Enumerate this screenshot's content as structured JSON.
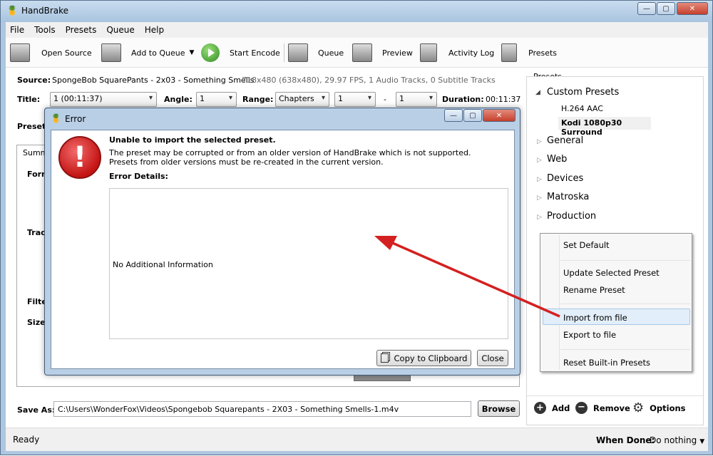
{
  "app": {
    "title": "HandBrake"
  },
  "menu": [
    "File",
    "Tools",
    "Presets",
    "Queue",
    "Help"
  ],
  "toolbar": {
    "open_source": "Open Source",
    "add_to_queue": "Add to Queue",
    "start_encode": "Start Encode",
    "queue": "Queue",
    "preview": "Preview",
    "activity_log": "Activity Log",
    "presets": "Presets"
  },
  "source": {
    "label": "Source:",
    "name": "SpongeBob SquarePants - 2x03 - Something Smells",
    "info": "718x480 (638x480), 29.97 FPS, 1 Audio Tracks, 0 Subtitle Tracks"
  },
  "title_row": {
    "title_label": "Title:",
    "title_value": "1  (00:11:37)",
    "angle_label": "Angle:",
    "angle_value": "1",
    "range_label": "Range:",
    "range_value": "Chapters",
    "range_from": "1",
    "dash": "-",
    "range_to": "1",
    "duration_label": "Duration:",
    "duration_value": "00:11:37"
  },
  "preset_label": "Preset:",
  "tabs": {
    "summary": "Summ"
  },
  "summary_labels": {
    "format": "Form",
    "tracks": "Track",
    "filters": "Filter",
    "size": "Size:"
  },
  "presets_panel": {
    "header": "Presets",
    "custom": "Custom Presets",
    "custom_items": [
      "H.264 AAC",
      "Kodi 1080p30 Surround"
    ],
    "groups": [
      "General",
      "Web",
      "Devices",
      "Matroska",
      "Production"
    ],
    "add": "Add",
    "remove": "Remove",
    "options": "Options"
  },
  "context_menu": {
    "set_default": "Set Default",
    "update": "Update Selected Preset",
    "rename": "Rename Preset",
    "import": "Import from file",
    "export": "Export to file",
    "reset": "Reset Built-in Presets"
  },
  "dialog": {
    "title": "Error",
    "heading": "Unable to import the selected preset.",
    "line1": "The preset may be corrupted or from an older version of HandBrake which is not supported.",
    "line2": "Presets from older versions must be re-created in the current version.",
    "details_label": "Error Details:",
    "details_text": "No Additional Information",
    "copy_button": "Copy to Clipboard",
    "close_button": "Close"
  },
  "save_as": {
    "label": "Save As:",
    "path": "C:\\Users\\WonderFox\\Videos\\Spongebob Squarepants - 2X03 - Something Smells-1.m4v",
    "browse": "Browse"
  },
  "status": {
    "text": "Ready",
    "when_done_label": "When Done:",
    "when_done_value": "Do nothing"
  },
  "colors": {
    "arrow": "#d42020",
    "error_icon": "#d21c1c",
    "play": "#3c9a2a"
  }
}
